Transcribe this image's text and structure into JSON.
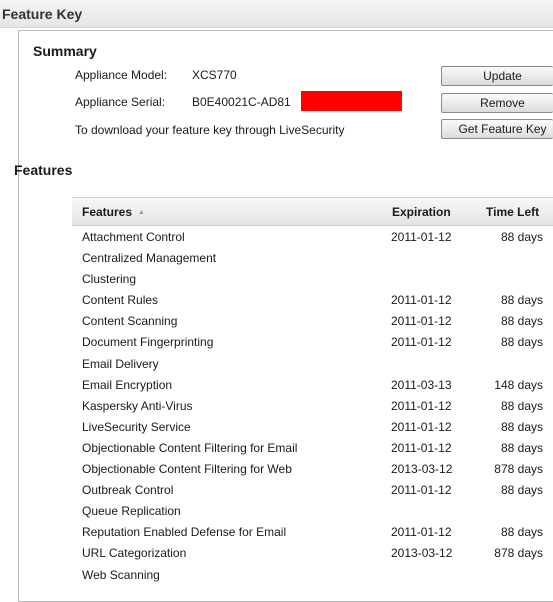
{
  "page": {
    "title": "Feature Key"
  },
  "summary": {
    "title": "Summary",
    "model_label": "Appliance Model:",
    "model_value": "XCS770",
    "serial_label": "Appliance Serial:",
    "serial_value": "B0E40021C-AD81",
    "download_text": "To download your feature key through LiveSecurity",
    "buttons": {
      "update": "Update",
      "remove": "Remove",
      "get_key": "Get Feature Key"
    }
  },
  "features": {
    "title": "Features",
    "columns": {
      "name": "Features",
      "expiration": "Expiration",
      "time_left": "Time Left"
    },
    "rows": [
      {
        "name": "Attachment Control",
        "expiration": "2011-01-12",
        "time_left": "88 days"
      },
      {
        "name": "Centralized Management",
        "expiration": "",
        "time_left": ""
      },
      {
        "name": "Clustering",
        "expiration": "",
        "time_left": ""
      },
      {
        "name": "Content Rules",
        "expiration": "2011-01-12",
        "time_left": "88 days"
      },
      {
        "name": "Content Scanning",
        "expiration": "2011-01-12",
        "time_left": "88 days"
      },
      {
        "name": "Document Fingerprinting",
        "expiration": "2011-01-12",
        "time_left": "88 days"
      },
      {
        "name": "Email Delivery",
        "expiration": "",
        "time_left": ""
      },
      {
        "name": "Email Encryption",
        "expiration": "2011-03-13",
        "time_left": "148 days"
      },
      {
        "name": "Kaspersky Anti-Virus",
        "expiration": "2011-01-12",
        "time_left": "88 days"
      },
      {
        "name": "LiveSecurity Service",
        "expiration": "2011-01-12",
        "time_left": "88 days"
      },
      {
        "name": "Objectionable Content Filtering for Email",
        "expiration": "2011-01-12",
        "time_left": "88 days"
      },
      {
        "name": "Objectionable Content Filtering for Web",
        "expiration": "2013-03-12",
        "time_left": "878 days"
      },
      {
        "name": "Outbreak Control",
        "expiration": "2011-01-12",
        "time_left": "88 days"
      },
      {
        "name": "Queue Replication",
        "expiration": "",
        "time_left": ""
      },
      {
        "name": "Reputation Enabled Defense for Email",
        "expiration": "2011-01-12",
        "time_left": "88 days"
      },
      {
        "name": "URL Categorization",
        "expiration": "2013-03-12",
        "time_left": "878 days"
      },
      {
        "name": "Web Scanning",
        "expiration": "",
        "time_left": ""
      }
    ]
  },
  "colors": {
    "redaction": "#ff0000",
    "border": "#b9b9b9"
  },
  "icons": {
    "sort": "sort-ascending-icon"
  }
}
